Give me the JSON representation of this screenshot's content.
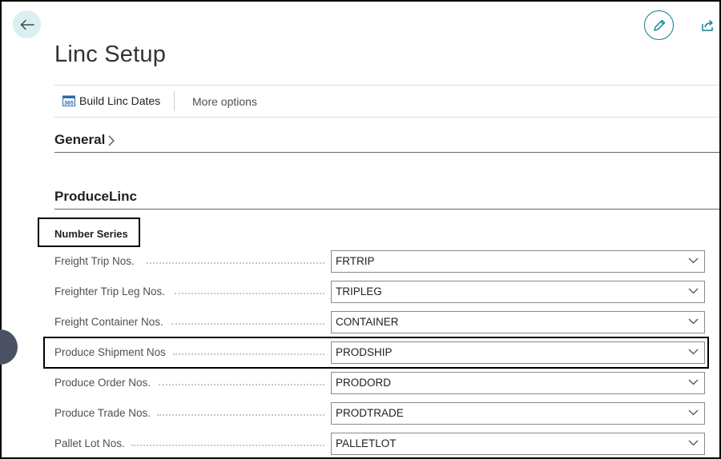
{
  "page": {
    "title": "Linc Setup"
  },
  "actions": {
    "build_label": "Build Linc Dates",
    "more_label": "More options"
  },
  "sections": {
    "general": "General",
    "produce": "ProduceLinc"
  },
  "group": {
    "label": "Number Series"
  },
  "fields": [
    {
      "label": "Freight Trip Nos.",
      "value": "FRTRIP"
    },
    {
      "label": "Freighter Trip Leg Nos.",
      "value": "TRIPLEG"
    },
    {
      "label": "Freight Container Nos.",
      "value": "CONTAINER"
    },
    {
      "label": "Produce Shipment Nos",
      "value": "PRODSHIP"
    },
    {
      "label": "Produce Order Nos.",
      "value": "PRODORD"
    },
    {
      "label": "Produce Trade Nos.",
      "value": "PRODTRADE"
    },
    {
      "label": "Pallet Lot Nos.",
      "value": "PALLETLOT"
    }
  ],
  "icons": {
    "back": "arrow-left-icon",
    "edit": "pencil-icon",
    "share": "share-icon",
    "build": "calendar-icon",
    "expand": "chevron-right-icon",
    "dropdown": "chevron-down-icon"
  },
  "colors": {
    "accent": "#0a7f87",
    "back_bg": "#dbeff0",
    "side_tab": "#4a5163"
  }
}
